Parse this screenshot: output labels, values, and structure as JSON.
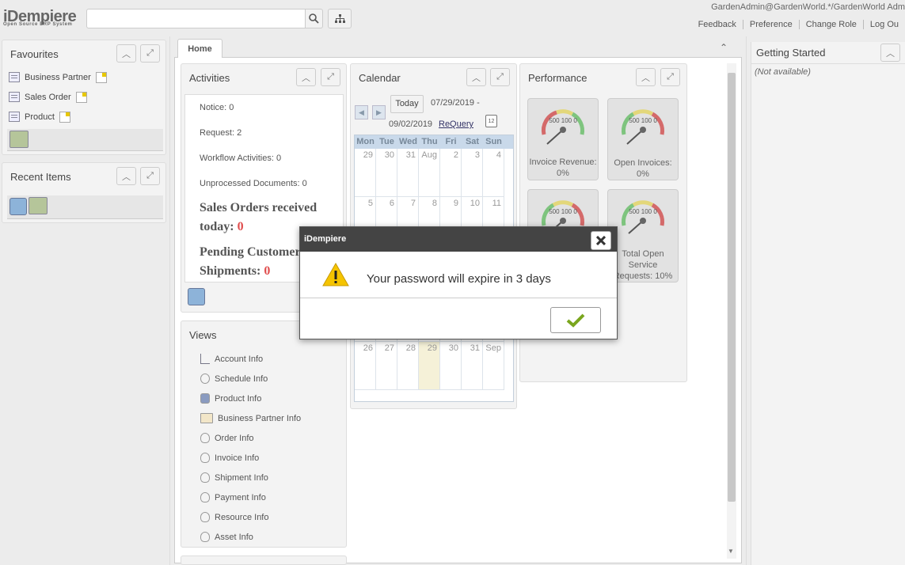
{
  "header": {
    "logo": "iDempiere",
    "logo_sub": "Open Source ERP System",
    "search_value": "",
    "user": "GardenAdmin@GardenWorld.*/GardenWorld Adm",
    "links": [
      "Feedback",
      "Preference",
      "Change Role",
      "Log Ou"
    ]
  },
  "favourites": {
    "title": "Favourites",
    "items": [
      {
        "label": "Business Partner",
        "icon": "document-icon"
      },
      {
        "label": "Sales Order",
        "icon": "document-icon"
      },
      {
        "label": "Product",
        "icon": "document-icon"
      }
    ]
  },
  "recent": {
    "title": "Recent Items"
  },
  "tabs": [
    {
      "label": "Home",
      "active": true
    }
  ],
  "activities": {
    "title": "Activities",
    "lines": [
      "Notice: 0",
      "Request: 2",
      "Workflow Activities: 0",
      "Unprocessed Documents: 0"
    ],
    "sales_label": "Sales Orders received today:",
    "sales_value": "0",
    "pending_label": "Pending Customer Shipments:",
    "pending_value": "0"
  },
  "views": {
    "title": "Views",
    "items": [
      "Account Info",
      "Schedule Info",
      "Product Info",
      "Business Partner Info",
      "Order Info",
      "Invoice Info",
      "Shipment Info",
      "Payment Info",
      "Resource Info",
      "Asset Info"
    ]
  },
  "calendar": {
    "title": "Calendar",
    "today_label": "Today",
    "range_start": "07/29/2019 -",
    "range_end": "09/02/2019",
    "requery": "ReQuery",
    "cal_icon_num": "12",
    "days": [
      "Mon",
      "Tue",
      "Wed",
      "Thu",
      "Fri",
      "Sat",
      "Sun"
    ],
    "week1": [
      "29",
      "30",
      "31",
      "Aug",
      "2",
      "3",
      "4"
    ],
    "week2": [
      "5",
      "6",
      "7",
      "8",
      "9",
      "10",
      "11"
    ],
    "week_last": [
      "26",
      "27",
      "28",
      "29",
      "30",
      "31",
      "Sep"
    ]
  },
  "performance": {
    "title": "Performance",
    "gauges": [
      {
        "label": "Invoice Revenue: 0%",
        "ticks": "500 100 0",
        "level": 0
      },
      {
        "label": "Open Invoices: 0%",
        "ticks": "500 100 0",
        "level": 0
      },
      {
        "label": "",
        "ticks": "500 100 0",
        "level": 0
      },
      {
        "label": "Total Open Service Requests: 10%",
        "ticks": "500 100 0",
        "level": 10
      }
    ]
  },
  "getting_started": {
    "title": "Getting Started",
    "value": "(Not available)"
  },
  "dialog": {
    "title": "iDempiere",
    "message": "Your password will expire in 3 days"
  }
}
